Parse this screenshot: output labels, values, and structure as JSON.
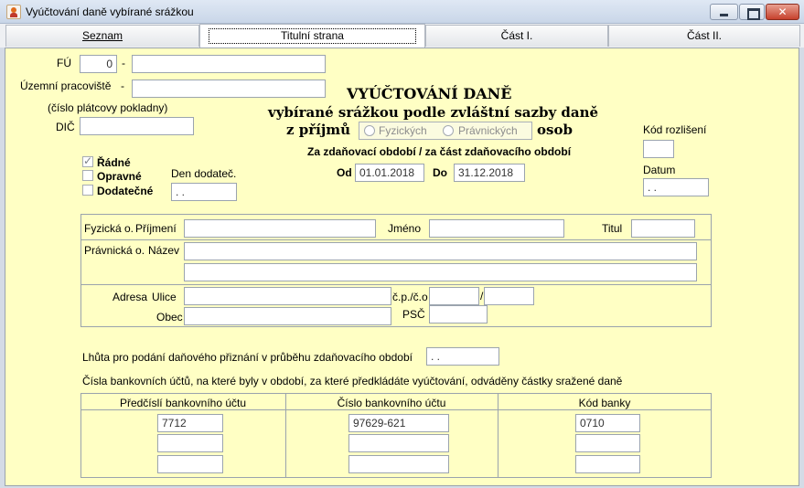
{
  "window": {
    "title": "Vyúčtování daně vybírané srážkou"
  },
  "tabs": [
    {
      "label": "Seznam",
      "active": false
    },
    {
      "label": "Titulní strana",
      "active": true
    },
    {
      "label": "Část I.",
      "active": false
    },
    {
      "label": "Část II.",
      "active": false
    }
  ],
  "header": {
    "fu_label": "FÚ",
    "fu_value": "0",
    "dash": "-",
    "uzemni_label": "Územní pracoviště",
    "dic_note": "(číslo plátcovy pokladny)",
    "dic_label": "DIČ",
    "title_line1": "VYÚČTOVÁNÍ DANĚ",
    "title_line2": "vybírané srážkou podle zvláštní sazby daně",
    "title_line3a": "z příjmů",
    "title_line3b": "osob",
    "radio_fyzickych": "Fyzických",
    "radio_pravnickych": "Právnických",
    "kod_rozliseni_label": "Kód rozlišení",
    "datum_label": "Datum",
    "datum_value": " .  .",
    "obdobi_label": "Za zdaňovací období / za část zdaňovacího období",
    "od_label": "Od",
    "od_value": "01.01.2018",
    "do_label": "Do",
    "do_value": "31.12.2018"
  },
  "type": {
    "radne": "Řádné",
    "radne_checked": true,
    "opravne": "Opravné",
    "dodatecne": "Dodatečné",
    "den_dodatec_label": "Den dodateč.",
    "den_dodatec_value": " .  ."
  },
  "taxpayer": {
    "fyzicka_label": "Fyzická o.",
    "prijmeni_label": "Příjmení",
    "jmeno_label": "Jméno",
    "titul_label": "Titul",
    "pravnicka_label": "Právnická o.",
    "nazev_label": "Název",
    "adresa_label": "Adresa",
    "ulice_label": "Ulice",
    "cp_label": "č.p./č.o",
    "slash": "/",
    "obec_label": "Obec",
    "psc_label": "PSČ"
  },
  "deadline": {
    "label": "Lhůta pro podání daňového přiznání v průběhu zdaňovacího období",
    "value": " .  ."
  },
  "bank": {
    "note": "Čísla bankovních účtů, na které byly v období, za které předkládáte vyúčtování, odváděny částky sražené daně",
    "col1": "Předčíslí bankovního účtu",
    "col2": "Číslo bankovního účtu",
    "col3": "Kód banky",
    "rows": [
      {
        "prefix": "7712",
        "number": "97629-621",
        "code": "0710"
      },
      {
        "prefix": "",
        "number": "",
        "code": ""
      },
      {
        "prefix": "",
        "number": "",
        "code": ""
      }
    ]
  }
}
